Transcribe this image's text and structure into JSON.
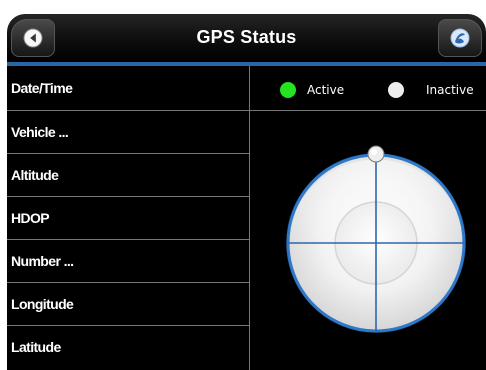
{
  "header": {
    "title": "GPS Status",
    "back_icon": "arrow-left-icon",
    "logo_icon": "nav-logo-icon"
  },
  "status_rows": [
    {
      "label": "Date/Time"
    },
    {
      "label": "Vehicle ..."
    },
    {
      "label": "Altitude"
    },
    {
      "label": "HDOP"
    },
    {
      "label": "Number ..."
    },
    {
      "label": "Longitude"
    },
    {
      "label": "Latitude"
    }
  ],
  "legend": {
    "active_label": "Active",
    "inactive_label": "Inactive",
    "active_color": "#23e41f",
    "inactive_color": "#ededed"
  },
  "colors": {
    "header_accent": "#2d63a7",
    "crosshair": "#2e67ad",
    "background": "#000000"
  }
}
